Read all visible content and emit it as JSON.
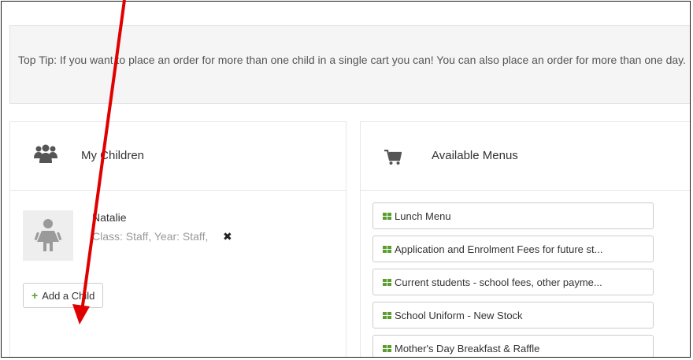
{
  "tip": {
    "text": "Top Tip: If you want to place an order for more than one child in a single cart you can! You can also place an order for more than one day."
  },
  "children_panel": {
    "title": "My Children",
    "icon": "users-icon",
    "children": [
      {
        "name": "Natalie",
        "meta": "Class: Staff, Year: Staff,",
        "remove_icon": "✖"
      }
    ],
    "add_label": "Add a Child"
  },
  "menus_panel": {
    "title": "Available Menus",
    "icon": "cart-icon",
    "items": [
      {
        "label": "Lunch Menu"
      },
      {
        "label": "Application and Enrolment Fees for future st..."
      },
      {
        "label": "Current students - school fees, other payme..."
      },
      {
        "label": "School Uniform - New Stock"
      },
      {
        "label": "Mother's Day Breakfast & Raffle"
      }
    ]
  },
  "colors": {
    "accent_green": "#5a9e2e",
    "annotation_arrow": "#e00000",
    "tip_background": "#f5f5f5"
  }
}
